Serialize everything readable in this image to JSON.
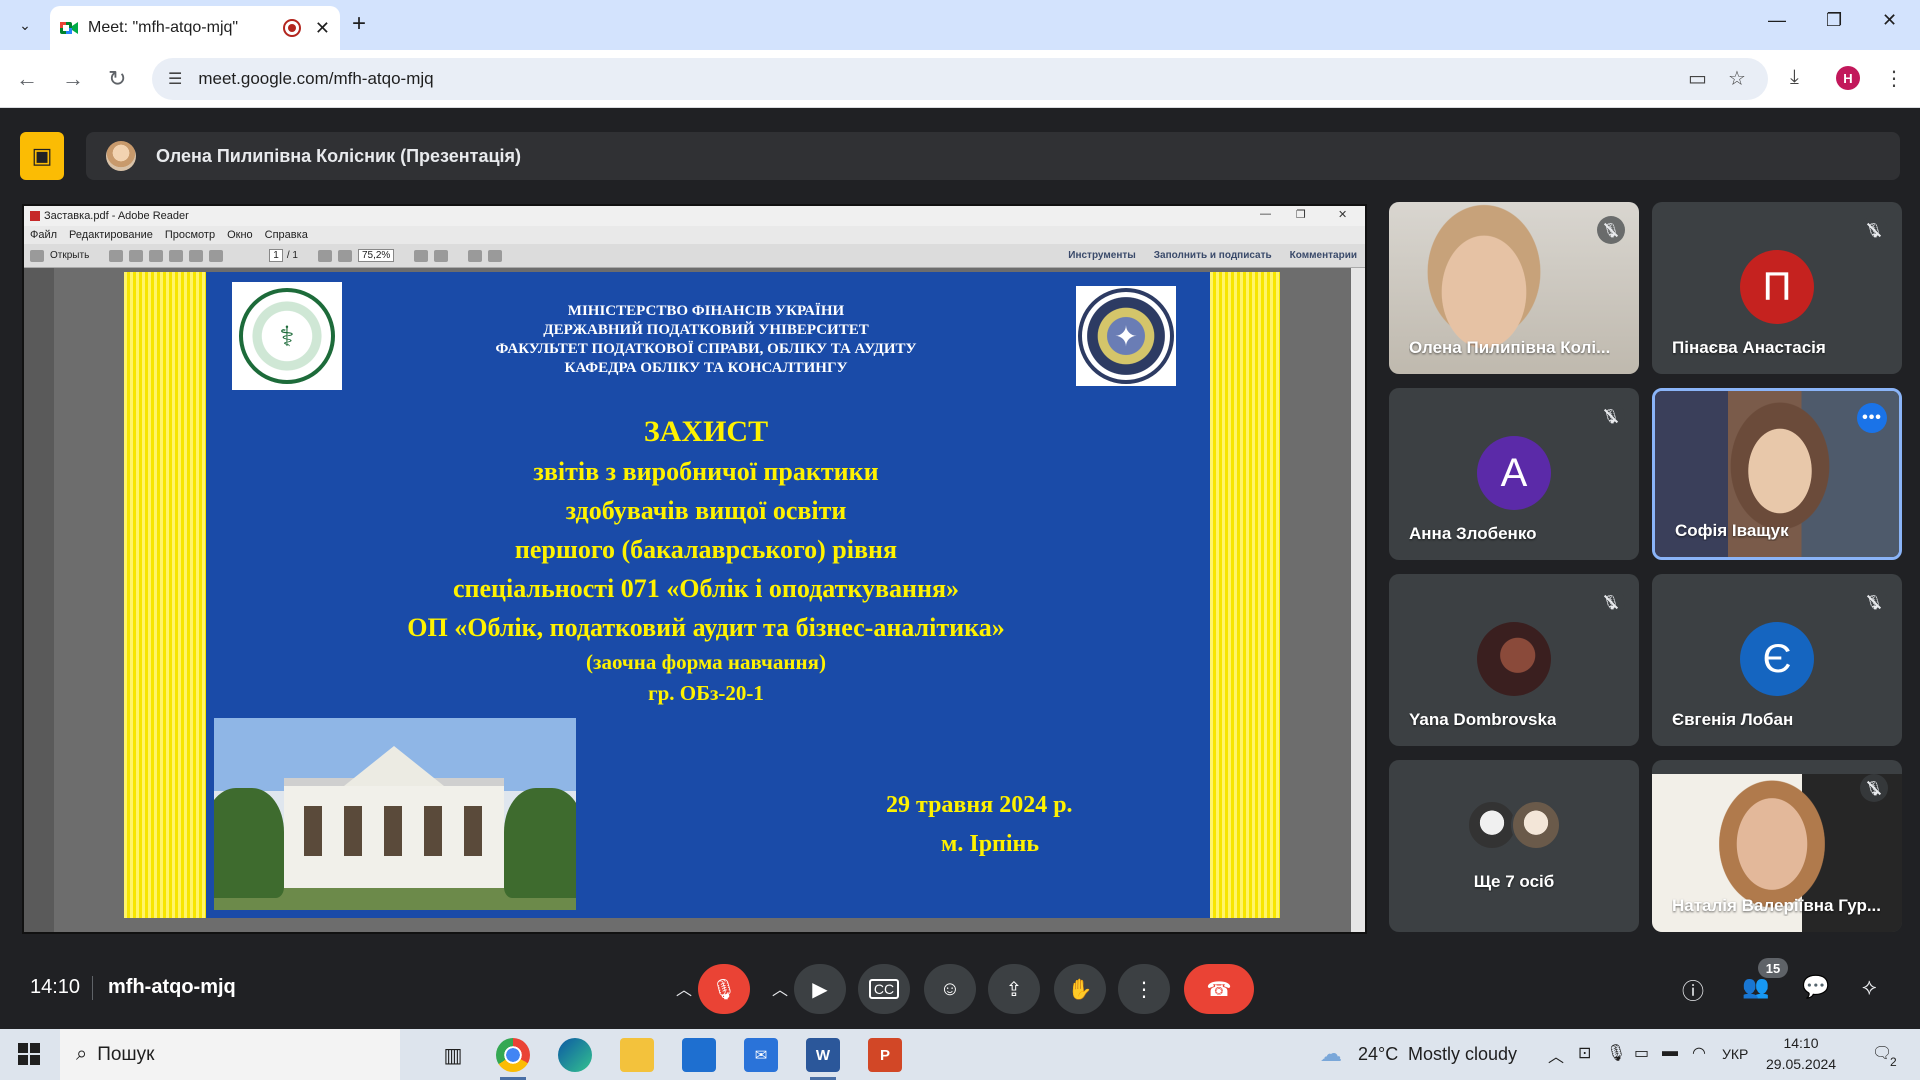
{
  "browser": {
    "tab_title": "Meet: \"mfh-atqo-mjq\"",
    "url": "meet.google.com/mfh-atqo-mjq",
    "profile_initial": "H"
  },
  "meet": {
    "presenter_banner": "Олена Пилипівна Колісник (Презентація)",
    "time": "14:10",
    "meeting_code": "mfh-atqo-mjq",
    "participants_count": "15"
  },
  "reader": {
    "window_title": "Заставка.pdf - Adobe Reader",
    "menu": [
      "Файл",
      "Редактирование",
      "Просмотр",
      "Окно",
      "Справка"
    ],
    "open_label": "Открыть",
    "page_value": "1",
    "page_total": "/ 1",
    "zoom": "75,2%",
    "right_tools": [
      "Инструменты",
      "Заполнить и подписать",
      "Комментарии"
    ]
  },
  "slide": {
    "header_lines": [
      "МІНІСТЕРСТВО ФІНАНСІВ УКРАЇНИ",
      "ДЕРЖАВНИЙ ПОДАТКОВИЙ УНІВЕРСИТЕТ",
      "ФАКУЛЬТЕТ ПОДАТКОВОЇ СПРАВИ, ОБЛІКУ ТА АУДИТУ",
      "КАФЕДРА ОБЛІКУ ТА КОНСАЛТИНГУ"
    ],
    "title": "ЗАХИСТ",
    "lines": [
      "звітів з виробничої практики",
      "здобувачів вищої освіти",
      "першого (бакалаврського) рівня",
      "спеціальності 071 «Облік і оподаткування»",
      "ОП «Облік, податковий аудит та бізнес-аналітика»"
    ],
    "form_line": "(заочна форма навчання)",
    "group_line": "гр. ОБз-20-1",
    "date": "29 травня 2024 р.",
    "city": "м. Ірпінь"
  },
  "participants": [
    {
      "name": "Олена Пилипівна Колі...",
      "type": "video",
      "muted": true
    },
    {
      "name": "Пінаєва Анастасія",
      "type": "initial",
      "initial": "П",
      "color": "#c5221f",
      "muted": true
    },
    {
      "name": "Анна Злобенко",
      "type": "initial",
      "initial": "А",
      "color": "#5b2aa8",
      "muted": true
    },
    {
      "name": "Софія Іващук",
      "type": "video",
      "muted": false,
      "active": true
    },
    {
      "name": "Yana Dombrovska",
      "type": "photo",
      "muted": true
    },
    {
      "name": "Євгенія Лобан",
      "type": "initial",
      "initial": "Є",
      "color": "#1565c0",
      "muted": true
    },
    {
      "name": "Ще 7 осіб",
      "type": "group"
    },
    {
      "name": "Наталія Валеріївна Гур...",
      "type": "video",
      "muted": true
    }
  ],
  "taskbar": {
    "search_placeholder": "Пошук",
    "weather_temp": "24°C",
    "weather_text": "Mostly cloudy",
    "lang": "УКР",
    "time": "14:10",
    "date": "29.05.2024",
    "notif_count": "2"
  },
  "colors": {
    "meet_bg": "#202124",
    "tile_bg": "#3c4043",
    "slide_blue": "#1a4ba8",
    "slide_yellow": "#fff200",
    "end_call": "#ea4335",
    "presenting_accent": "#fbbc04"
  }
}
